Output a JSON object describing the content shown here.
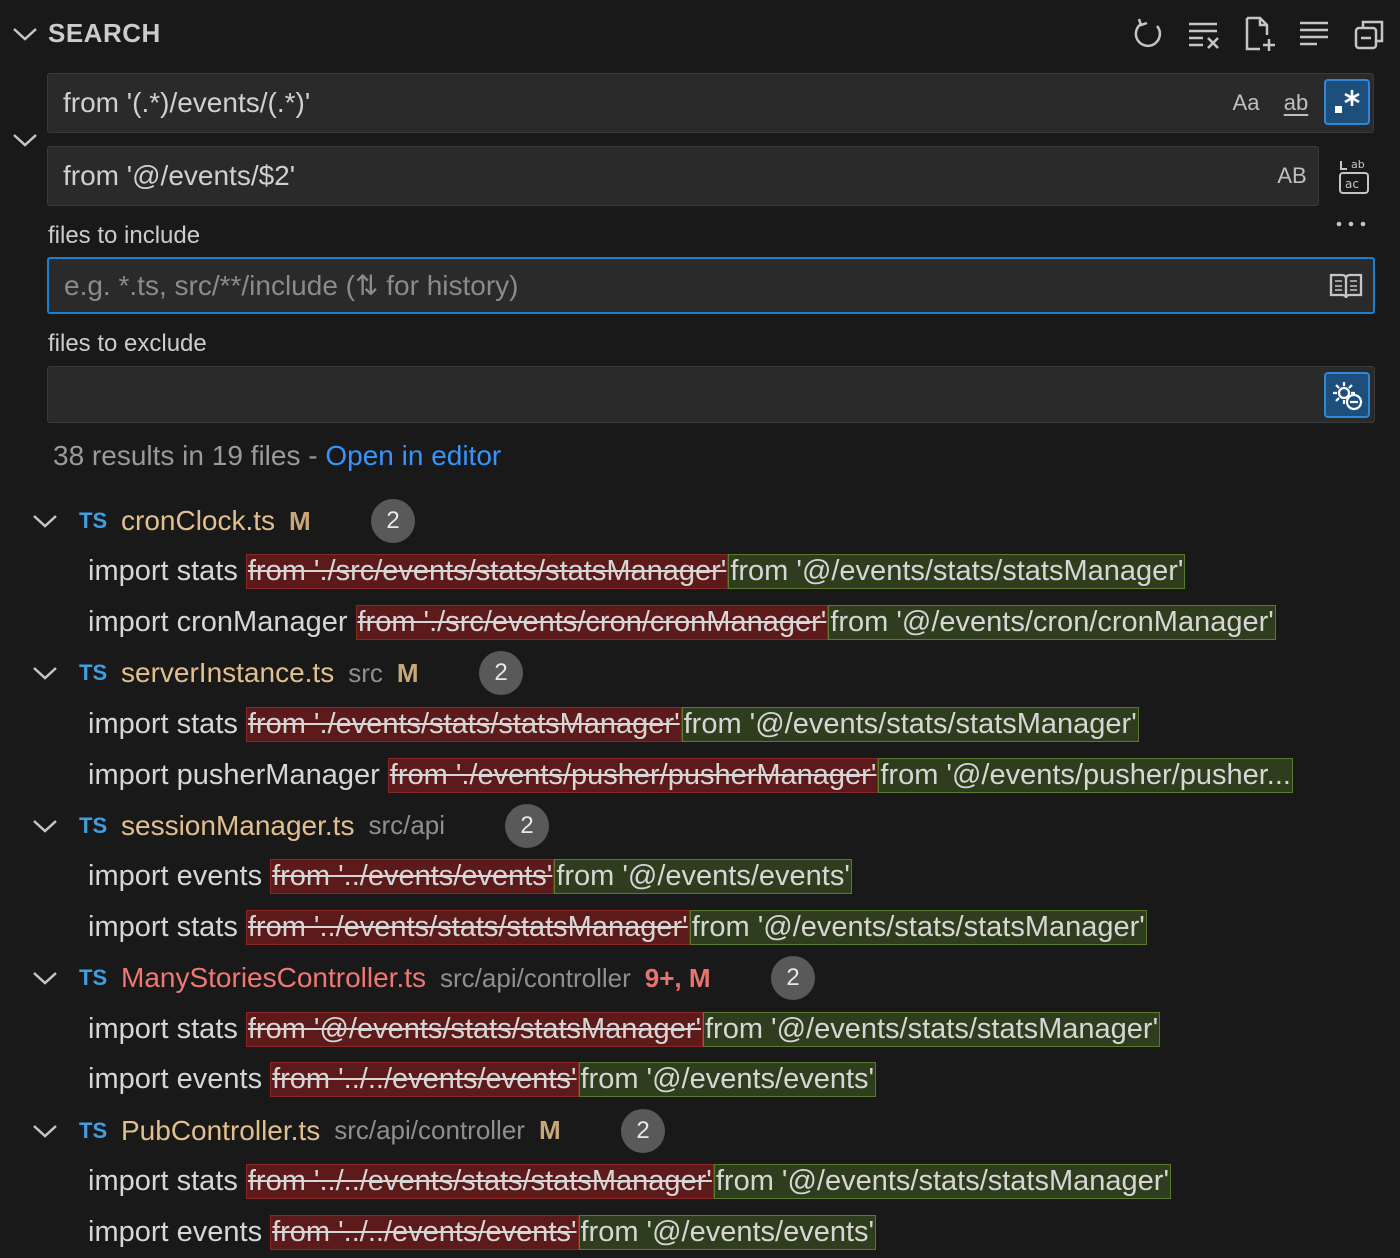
{
  "header": {
    "title": "SEARCH",
    "actions": [
      "refresh-icon",
      "clear-results-icon",
      "new-search-editor-icon",
      "view-as-tree-icon",
      "collapse-all-icon"
    ]
  },
  "search": {
    "value": "from '(.*)/events/(.*)'",
    "toggles": {
      "match_case": "Aa",
      "whole_word": "ab",
      "regex": ".*"
    }
  },
  "replace": {
    "value": "from '@/events/$2'",
    "preserve_case": "AB"
  },
  "include": {
    "label": "files to include",
    "placeholder": "e.g. *.ts, src/**/include (⇅ for history)"
  },
  "exclude": {
    "label": "files to exclude",
    "value": ""
  },
  "summary": {
    "text": "38 results in 19 files - ",
    "link": "Open in editor"
  },
  "results": [
    {
      "name": "cronClock.ts",
      "path": "",
      "status": "M",
      "count": "2",
      "error": false,
      "matches": [
        {
          "prefix": "import stats",
          "removed": "from './src/events/stats/statsManager'",
          "added": "from '@/events/stats/statsManager'"
        },
        {
          "prefix": "import cronManager",
          "removed": "from './src/events/cron/cronManager'",
          "added": "from '@/events/cron/cronManager'"
        }
      ]
    },
    {
      "name": "serverInstance.ts",
      "path": "src",
      "status": "M",
      "count": "2",
      "error": false,
      "matches": [
        {
          "prefix": "import stats",
          "removed": "from './events/stats/statsManager'",
          "added": "from '@/events/stats/statsManager'"
        },
        {
          "prefix": "import pusherManager",
          "removed": "from './events/pusher/pusherManager'",
          "added": "from '@/events/pusher/pusher..."
        }
      ]
    },
    {
      "name": "sessionManager.ts",
      "path": "src/api",
      "status": "",
      "count": "2",
      "error": false,
      "matches": [
        {
          "prefix": "import events",
          "removed": "from '../events/events'",
          "added": "from '@/events/events'"
        },
        {
          "prefix": "import stats",
          "removed": "from '../events/stats/statsManager'",
          "added": "from '@/events/stats/statsManager'"
        }
      ]
    },
    {
      "name": "ManyStoriesController.ts",
      "path": "src/api/controller",
      "status": "9+, M",
      "count": "2",
      "error": true,
      "matches": [
        {
          "prefix": "import stats",
          "removed": "from '@/events/stats/statsManager'",
          "added": "from '@/events/stats/statsManager'"
        },
        {
          "prefix": "import events",
          "removed": "from '../../events/events'",
          "added": "from '@/events/events'"
        }
      ]
    },
    {
      "name": "PubController.ts",
      "path": "src/api/controller",
      "status": "M",
      "count": "2",
      "error": false,
      "matches": [
        {
          "prefix": "import stats",
          "removed": "from '../../events/stats/statsManager'",
          "added": "from '@/events/stats/statsManager'"
        },
        {
          "prefix": "import events",
          "removed": "from '../../events/events'",
          "added": "from '@/events/events'"
        }
      ]
    }
  ],
  "file_icon_label": "TS",
  "colors": {
    "background": "#191919",
    "accent": "#1d80cf",
    "link": "#3794ff",
    "removed_bg": "#5c1a1a",
    "added_bg": "#2d3d1d",
    "modified": "#e2c08d",
    "error": "#f07774"
  }
}
